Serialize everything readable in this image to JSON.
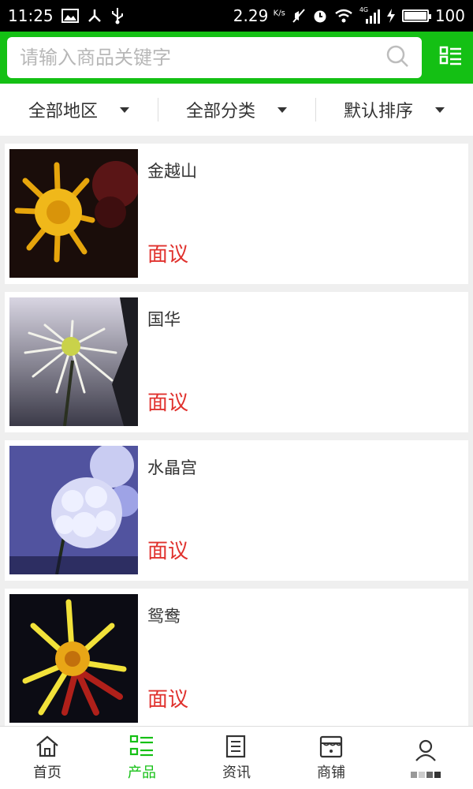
{
  "status_bar": {
    "time": "11:25",
    "speed": "2.29",
    "speed_unit": "K/s",
    "network": "4G",
    "battery": "100",
    "battery_level": 1.0
  },
  "search": {
    "placeholder": "请输入商品关键字"
  },
  "filters": [
    {
      "label": "全部地区"
    },
    {
      "label": "全部分类"
    },
    {
      "label": "默认排序"
    }
  ],
  "products": [
    {
      "name": "金越山",
      "price": "面议"
    },
    {
      "name": "国华",
      "price": "面议"
    },
    {
      "name": "水晶宫",
      "price": "面议"
    },
    {
      "name": "鸳鸯",
      "price": "面议"
    }
  ],
  "nav": [
    {
      "label": "首页",
      "icon": "home-icon"
    },
    {
      "label": "产品",
      "icon": "list-icon"
    },
    {
      "label": "资讯",
      "icon": "news-icon"
    },
    {
      "label": "商铺",
      "icon": "shop-icon"
    },
    {
      "label": "",
      "icon": "user-icon"
    }
  ],
  "colors": {
    "brand": "#14c014",
    "price": "#e0322e"
  }
}
